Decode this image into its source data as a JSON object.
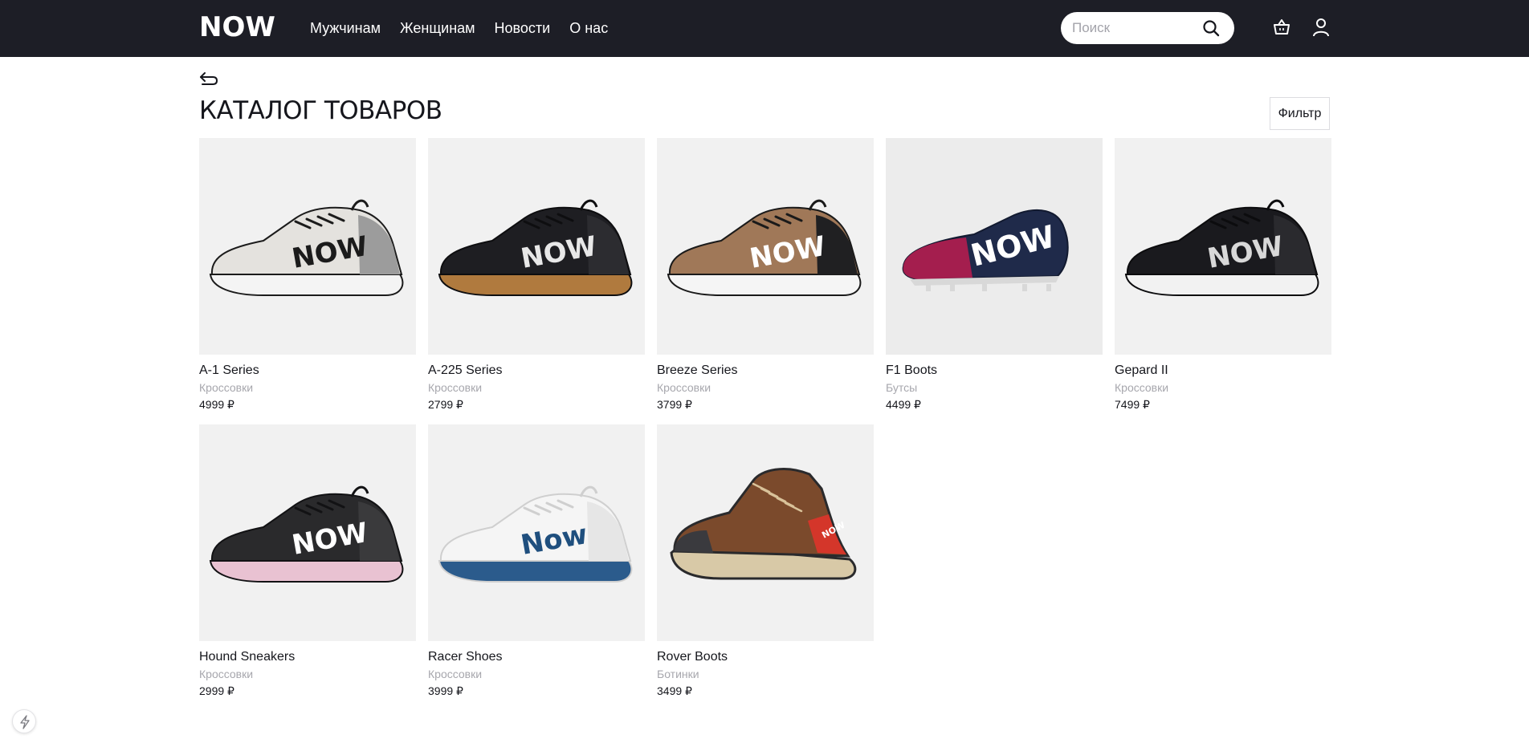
{
  "header": {
    "logo": "NOW",
    "nav": [
      "Мужчинам",
      "Женщинам",
      "Новости",
      "О нас"
    ],
    "search_placeholder": "Поиск",
    "search_value": "",
    "icons": [
      "search-icon",
      "cart-icon",
      "user-icon"
    ],
    "colors": {
      "background": "#1d1e26",
      "text": "#ffffff"
    }
  },
  "catalog": {
    "title": "КАТАЛОГ ТОВАРОВ",
    "filter_label": "Фильтр",
    "back_icon": "back-arrow-icon"
  },
  "products": [
    {
      "name": "A-1 Series",
      "category": "Кроссовки",
      "price": "4999 ₽",
      "logo": "NOW",
      "colors": {
        "upper": "#e4e2de",
        "accent": "#9c9c9c",
        "sole": "#f4f4f4",
        "line": "#1b1b1b",
        "logo": "#1b1b1b"
      }
    },
    {
      "name": "A-225 Series",
      "category": "Кроссовки",
      "price": "2799 ₽",
      "logo": "NOW",
      "colors": {
        "upper": "#1e1e22",
        "accent": "#2c2c30",
        "sole": "#b07a3e",
        "line": "#0e0e10",
        "logo": "#e8e8e8"
      }
    },
    {
      "name": "Breeze Series",
      "category": "Кроссовки",
      "price": "3799 ₽",
      "logo": "NOW",
      "colors": {
        "upper": "#a07858",
        "accent": "#202022",
        "sole": "#f5f5f5",
        "line": "#1a1a1a",
        "logo": "#ffffff"
      }
    },
    {
      "name": "F1 Boots",
      "category": "Бутсы",
      "price": "4499 ₽",
      "logo": "NOW",
      "colors": {
        "upper": "#1f2a4a",
        "accent": "#a41e4e",
        "sole": "#d8d8d8",
        "line": "#121a30",
        "logo": "#ffffff"
      }
    },
    {
      "name": "Gepard II",
      "category": "Кроссовки",
      "price": "7499 ₽",
      "logo": "NOW",
      "colors": {
        "upper": "#1a1a1e",
        "accent": "#2a2a2e",
        "sole": "#f2f2f2",
        "line": "#0c0c0e",
        "logo": "#d8d8d8"
      }
    },
    {
      "name": "Hound Sneakers",
      "category": "Кроссовки",
      "price": "2999 ₽",
      "logo": "NOW",
      "colors": {
        "upper": "#2a2a2c",
        "accent": "#3a3a3c",
        "sole": "#e9c2d2",
        "line": "#121214",
        "logo": "#ffffff"
      }
    },
    {
      "name": "Racer Shoes",
      "category": "Кроссовки",
      "price": "3999 ₽",
      "logo": "Now",
      "colors": {
        "upper": "#f5f5f5",
        "accent": "#e6e6e6",
        "sole": "#2b5b8c",
        "line": "#cfcfcf",
        "logo": "#1f4f7e"
      }
    },
    {
      "name": "Rover Boots",
      "category": "Ботинки",
      "price": "3499 ₽",
      "logo": "NOW",
      "colors": {
        "upper": "#7b4a2c",
        "accent": "#d4362a",
        "sole": "#d8c9a7",
        "line": "#2a2a2c",
        "logo": "#ffffff"
      }
    }
  ]
}
